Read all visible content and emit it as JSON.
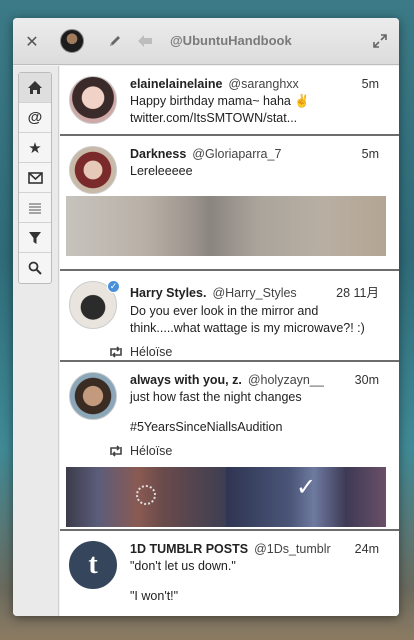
{
  "window": {
    "account": "@UbuntuHandbook",
    "icons": {
      "close": "close-icon",
      "compose": "pencil-icon",
      "back": "arrow-left-icon",
      "maximize": "maximize-icon"
    }
  },
  "sidebar": {
    "items": [
      {
        "name": "home",
        "icon": "home-icon",
        "active": true
      },
      {
        "name": "mentions",
        "icon": "at-icon"
      },
      {
        "name": "favorites",
        "icon": "star-icon"
      },
      {
        "name": "messages",
        "icon": "envelope-icon"
      },
      {
        "name": "lists",
        "icon": "lines-icon"
      },
      {
        "name": "filters",
        "icon": "funnel-icon"
      },
      {
        "name": "search",
        "icon": "search-icon"
      }
    ]
  },
  "tweets": [
    {
      "name": "elainelainelaine",
      "handle": "@saranghxx",
      "time": "5m",
      "text": "Happy birthday mama~ haha ✌ twitter.com/ItsSMTOWN/stat..."
    },
    {
      "name": "Darkness",
      "handle": "@Gloriaparra_7",
      "time": "5m",
      "text": "Lereleeeee"
    },
    {
      "name": "Harry Styles.",
      "handle": "@Harry_Styles",
      "time": "28 11月",
      "text": "Do you ever look in the mirror and think.....what wattage is my microwave?! :)",
      "retweeted_by": "Héloïse"
    },
    {
      "name": "always with you, z.",
      "handle": "@holyzayn__",
      "time": "30m",
      "text1": "just how fast the night changes",
      "text2": "#5YearsSinceNiallsAudition",
      "retweeted_by": "Héloïse"
    },
    {
      "name": "1D TUMBLR POSTS",
      "handle": "@1Ds_tumblr",
      "time": "24m",
      "text1": "\"don't let us down.\"",
      "text2": "\"I won't!\""
    }
  ],
  "colors": {
    "divider": "#6d6d6d",
    "verified": "#4a90d9"
  }
}
